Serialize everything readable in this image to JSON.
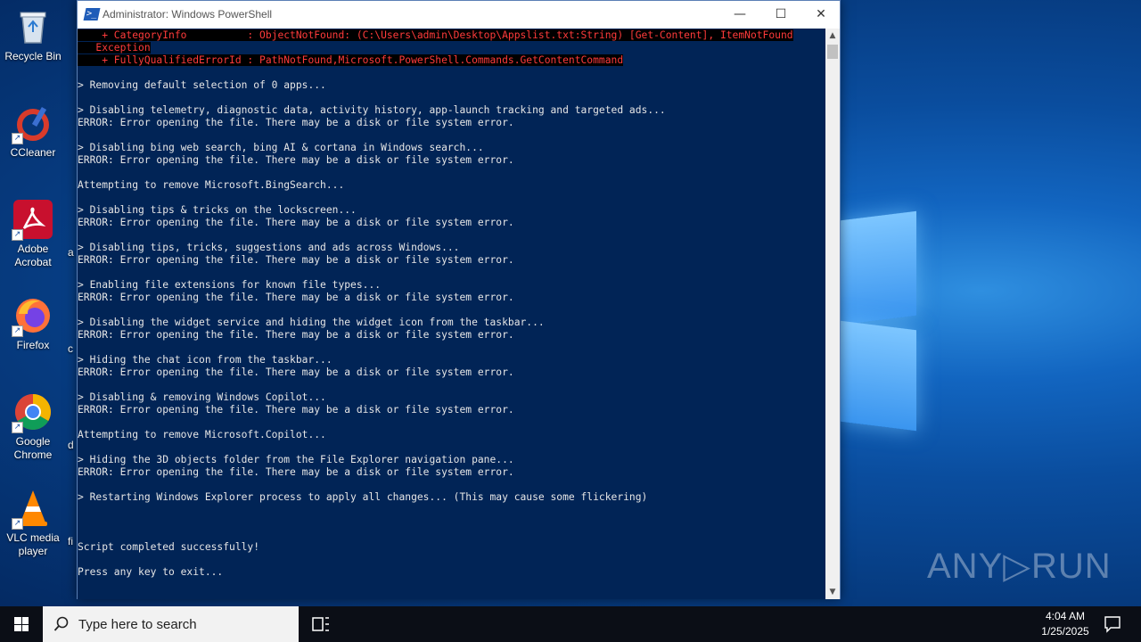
{
  "desktop_icons": [
    {
      "label": "Recycle Bin",
      "icon": "recycle-bin-icon"
    },
    {
      "label": "CCleaner",
      "icon": "ccleaner-icon"
    },
    {
      "label": "Adobe Acrobat",
      "icon": "acrobat-icon"
    },
    {
      "label": "Firefox",
      "icon": "firefox-icon"
    },
    {
      "label": "Google Chrome",
      "icon": "chrome-icon"
    },
    {
      "label": "VLC media player",
      "icon": "vlc-icon"
    }
  ],
  "desktop_col2_partial": [
    "a",
    "c",
    "d",
    "fi"
  ],
  "window": {
    "title": "Administrator: Windows PowerShell",
    "min_glyph": "—",
    "max_glyph": "☐",
    "close_glyph": "✕"
  },
  "console": {
    "lines": [
      {
        "text": "    + CategoryInfo          : ObjectNotFound: (C:\\Users\\admin\\Desktop\\Appslist.txt:String) [Get-Content], ItemNotFound",
        "error": true
      },
      {
        "text": "   Exception",
        "error": true
      },
      {
        "text": "    + FullyQualifiedErrorId : PathNotFound,Microsoft.PowerShell.Commands.GetContentCommand",
        "error": true
      },
      {
        "text": "",
        "error": false
      },
      {
        "text": "> Removing default selection of 0 apps...",
        "error": false
      },
      {
        "text": "",
        "error": false
      },
      {
        "text": "> Disabling telemetry, diagnostic data, activity history, app-launch tracking and targeted ads...",
        "error": false
      },
      {
        "text": "ERROR: Error opening the file. There may be a disk or file system error.",
        "error": false
      },
      {
        "text": "",
        "error": false
      },
      {
        "text": "> Disabling bing web search, bing AI & cortana in Windows search...",
        "error": false
      },
      {
        "text": "ERROR: Error opening the file. There may be a disk or file system error.",
        "error": false
      },
      {
        "text": "",
        "error": false
      },
      {
        "text": "Attempting to remove Microsoft.BingSearch...",
        "error": false
      },
      {
        "text": "",
        "error": false
      },
      {
        "text": "> Disabling tips & tricks on the lockscreen...",
        "error": false
      },
      {
        "text": "ERROR: Error opening the file. There may be a disk or file system error.",
        "error": false
      },
      {
        "text": "",
        "error": false
      },
      {
        "text": "> Disabling tips, tricks, suggestions and ads across Windows...",
        "error": false
      },
      {
        "text": "ERROR: Error opening the file. There may be a disk or file system error.",
        "error": false
      },
      {
        "text": "",
        "error": false
      },
      {
        "text": "> Enabling file extensions for known file types...",
        "error": false
      },
      {
        "text": "ERROR: Error opening the file. There may be a disk or file system error.",
        "error": false
      },
      {
        "text": "",
        "error": false
      },
      {
        "text": "> Disabling the widget service and hiding the widget icon from the taskbar...",
        "error": false
      },
      {
        "text": "ERROR: Error opening the file. There may be a disk or file system error.",
        "error": false
      },
      {
        "text": "",
        "error": false
      },
      {
        "text": "> Hiding the chat icon from the taskbar...",
        "error": false
      },
      {
        "text": "ERROR: Error opening the file. There may be a disk or file system error.",
        "error": false
      },
      {
        "text": "",
        "error": false
      },
      {
        "text": "> Disabling & removing Windows Copilot...",
        "error": false
      },
      {
        "text": "ERROR: Error opening the file. There may be a disk or file system error.",
        "error": false
      },
      {
        "text": "",
        "error": false
      },
      {
        "text": "Attempting to remove Microsoft.Copilot...",
        "error": false
      },
      {
        "text": "",
        "error": false
      },
      {
        "text": "> Hiding the 3D objects folder from the File Explorer navigation pane...",
        "error": false
      },
      {
        "text": "ERROR: Error opening the file. There may be a disk or file system error.",
        "error": false
      },
      {
        "text": "",
        "error": false
      },
      {
        "text": "> Restarting Windows Explorer process to apply all changes... (This may cause some flickering)",
        "error": false
      },
      {
        "text": "",
        "error": false
      },
      {
        "text": "",
        "error": false
      },
      {
        "text": "",
        "error": false
      },
      {
        "text": "Script completed successfully!",
        "error": false
      },
      {
        "text": "",
        "error": false
      },
      {
        "text": "Press any key to exit...",
        "error": false
      }
    ]
  },
  "watermark": "ANY▷RUN",
  "taskbar": {
    "search_placeholder": "Type here to search",
    "time": "4:04 AM",
    "date": "1/25/2025"
  },
  "colors": {
    "console_bg": "#012456",
    "console_fg": "#e6e6e6",
    "error_fg": "#ff3b3b",
    "taskbar_bg": "#0b0e16"
  }
}
